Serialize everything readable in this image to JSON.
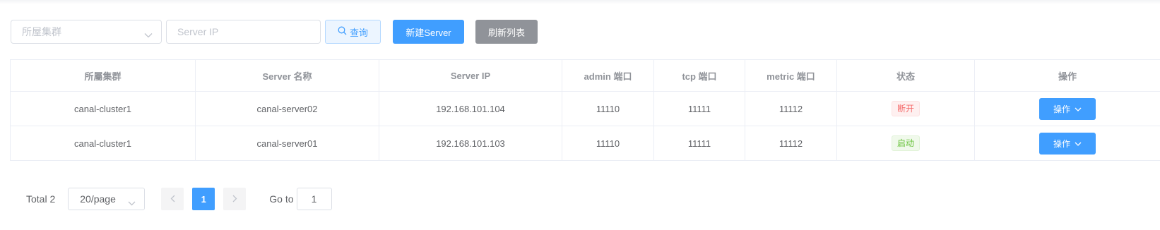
{
  "filters": {
    "cluster_placeholder": "所屋集群",
    "ip_placeholder": "Server IP",
    "query_label": "查询",
    "new_label": "新建Server",
    "refresh_label": "刷新列表"
  },
  "table": {
    "headers": [
      "所屬集群",
      "Server 名称",
      "Server IP",
      "admin 端口",
      "tcp 端口",
      "metric 端口",
      "状态",
      "操作"
    ],
    "rows": [
      {
        "cluster": "canal-cluster1",
        "name": "canal-server02",
        "ip": "192.168.101.104",
        "admin_port": "11110",
        "tcp_port": "11111",
        "metric_port": "11112",
        "status": "断开",
        "action": "操作"
      },
      {
        "cluster": "canal-cluster1",
        "name": "canal-server01",
        "ip": "192.168.101.103",
        "admin_port": "11110",
        "tcp_port": "11111",
        "metric_port": "11112",
        "status": "启动",
        "action": "操作"
      }
    ]
  },
  "pagination": {
    "total": "Total 2",
    "page_size": "20/page",
    "current_page": "1",
    "goto_label": "Go to",
    "goto_value": "1"
  },
  "colors": {
    "primary": "#409eff",
    "info": "#909399",
    "danger": "#f56c6c",
    "success": "#67c23a"
  }
}
